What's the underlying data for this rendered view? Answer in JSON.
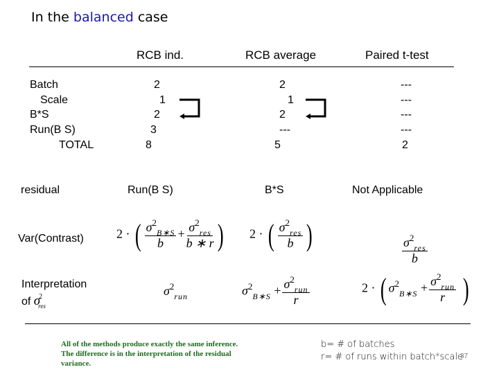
{
  "slide": {
    "title_prefix": "In the ",
    "title_accent": "balanced",
    "title_suffix": " case",
    "accent_color": "#1a1aa8",
    "page_number": "37"
  },
  "table": {
    "columns": [
      "RCB ind.",
      "RCB average",
      "Paired t-test"
    ],
    "row_labels": [
      "Batch",
      "Scale",
      "B*S",
      "Run(B S)",
      "TOTAL"
    ],
    "rcb_ind": [
      "2",
      "1",
      "2",
      "3",
      "8"
    ],
    "rcb_average": [
      "2",
      "1",
      "2",
      "---",
      "5"
    ],
    "paired_t": [
      "---",
      "---",
      "---",
      "---",
      "2"
    ],
    "residual_label": "residual",
    "residual": [
      "Run(B S)",
      "B*S",
      "Not Applicable"
    ],
    "var_contrast_label": "Var(Contrast)",
    "interpretation_label": "Interpretation",
    "interpretation_of": "of",
    "arrow_icons": [
      "return-arrow-icon",
      "return-arrow-icon"
    ]
  },
  "math": {
    "two_dot": "2 ·",
    "sigma": "σ",
    "sq": "2",
    "sub_bs": "B∗S",
    "sub_res": "res",
    "sub_run": "run",
    "b": "b",
    "r": "r",
    "b_times_r": "b ∗ r",
    "plus": "+",
    "lparen": "(",
    "rparen": ")"
  },
  "footer": {
    "note": "All of the methods produce exactly the same inference.  The difference is in the interpretation of the residual variance.",
    "note_color": "#1e6b1e",
    "legend_b": "b= # of batches",
    "legend_r": "r= # of runs within batch*scale"
  }
}
